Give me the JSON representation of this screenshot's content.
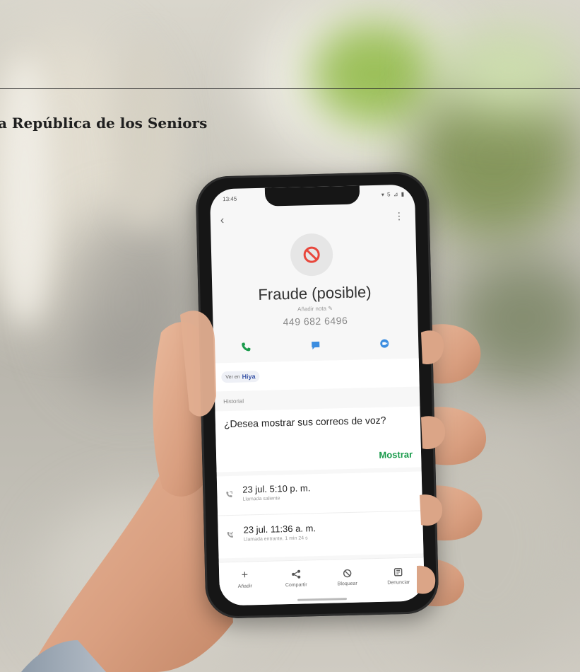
{
  "overlay": {
    "site_title": "a República de los Seniors"
  },
  "phone": {
    "status": {
      "time": "13:45",
      "icons": "▾ 5 ⊿ ▮"
    },
    "contact": {
      "name": "Fraude (posible)",
      "note": "Añadir nota ✎",
      "number": "449 682 6496"
    },
    "seen_in": {
      "prefix": "Ver en",
      "app": "Hiya"
    },
    "history_label": "Historial",
    "voicemail": {
      "question": "¿Desea mostrar sus correos de voz?",
      "button": "Mostrar"
    },
    "calls": [
      {
        "title": "23 jul. 5:10 p. m.",
        "subtitle": "Llamada saliente"
      },
      {
        "title": "23 jul. 11:36 a. m.",
        "subtitle": "Llamada entrante, 1 min 24 s"
      }
    ],
    "bottom_bar": [
      {
        "label": "Añadir",
        "icon": "plus-icon"
      },
      {
        "label": "Compartir",
        "icon": "share-icon"
      },
      {
        "label": "Bloquear",
        "icon": "block-icon"
      },
      {
        "label": "Denunciar",
        "icon": "report-icon"
      }
    ],
    "colors": {
      "accent_green": "#1a9b4c",
      "block_red": "#e8473c",
      "call_green": "#1a9b4c",
      "message_blue": "#3b8de0"
    }
  }
}
